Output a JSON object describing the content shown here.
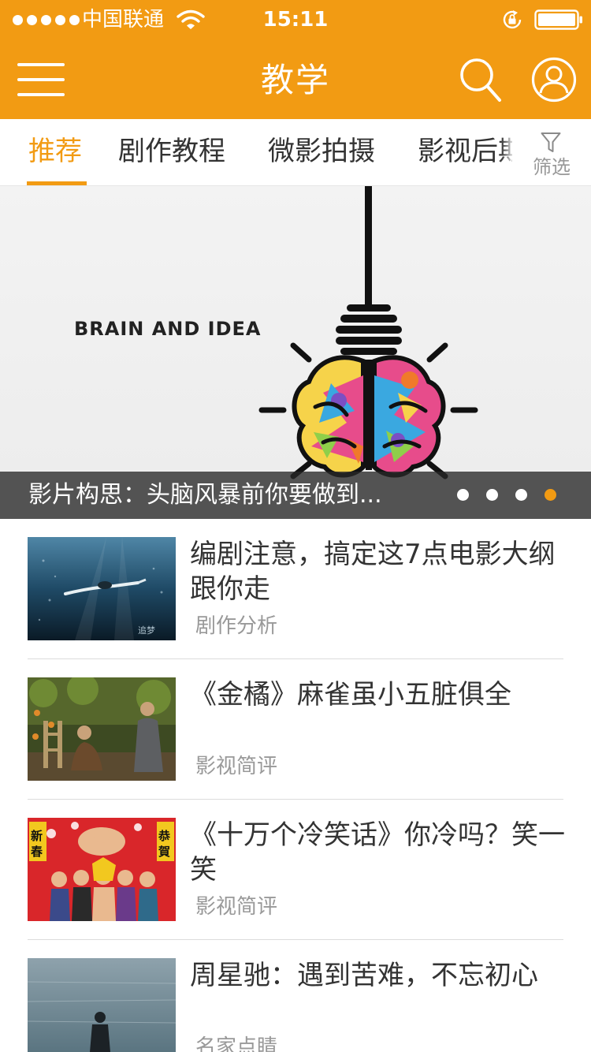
{
  "status_bar": {
    "carrier": "中国联通",
    "time": "15:11"
  },
  "nav": {
    "title": "教学"
  },
  "tabs": {
    "items": [
      {
        "label": "推荐",
        "active": true
      },
      {
        "label": "剧作教程",
        "active": false
      },
      {
        "label": "微影拍摄",
        "active": false
      },
      {
        "label": "影视后期",
        "active": false
      }
    ],
    "filter_label": "筛选"
  },
  "banner": {
    "image_text": "BRAIN AND IDEA",
    "caption": "影片构思：头脑风暴前你要做到...",
    "dot_count": 4,
    "active_index": 3
  },
  "articles": [
    {
      "title": "编剧注意，搞定这7点电影大纲跟你走",
      "tag": "剧作分析",
      "thumbnail": "underwater-swimmer-image"
    },
    {
      "title": "《金橘》麻雀虽小五脏俱全",
      "tag": "影视简评",
      "thumbnail": "orchard-men-image"
    },
    {
      "title": "《十万个冷笑话》你冷吗？笑一笑",
      "tag": "影视简评",
      "thumbnail": "anime-characters-poster"
    },
    {
      "title": "周星驰：遇到苦难，不忘初心",
      "tag": "名家点睛",
      "thumbnail": "man-by-sea-image"
    }
  ],
  "colors": {
    "accent": "#f29b13",
    "text_primary": "#333333",
    "text_secondary": "#999999"
  },
  "icons": [
    "signal-dots-icon",
    "wifi-icon",
    "lock-rotation-icon",
    "battery-icon",
    "menu-icon",
    "search-icon",
    "user-icon",
    "filter-icon"
  ]
}
